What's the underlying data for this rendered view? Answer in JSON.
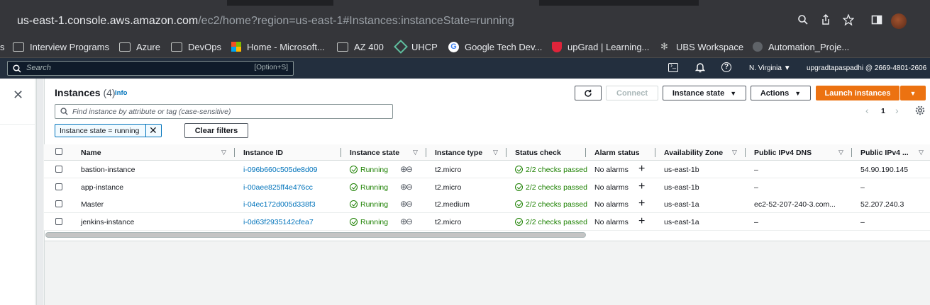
{
  "browser": {
    "url_host": "us-east-1.console.aws.amazon.com",
    "url_path": "/ec2/home?region=us-east-1#Instances:instanceState=running"
  },
  "bookmarks": [
    {
      "label": "Interview Programs",
      "icon": "folder-icon"
    },
    {
      "label": "Azure",
      "icon": "folder-icon"
    },
    {
      "label": "DevOps",
      "icon": "folder-icon"
    },
    {
      "label": "Home - Microsoft...",
      "icon": "microsoft-logo-icon"
    },
    {
      "label": "AZ 400",
      "icon": "folder-icon"
    },
    {
      "label": "UHCP",
      "icon": "uhcp-icon"
    },
    {
      "label": "Google Tech Dev...",
      "icon": "google-icon"
    },
    {
      "label": "upGrad | Learning...",
      "icon": "upgrad-icon"
    },
    {
      "label": "UBS Workspace",
      "icon": "ubs-icon"
    },
    {
      "label": "Automation_Proje...",
      "icon": "github-icon"
    }
  ],
  "aws_nav": {
    "search_placeholder": "Search",
    "search_shortcut": "[Option+S]",
    "region": "N. Virginia",
    "account": "upgradtapaspadhi @ 2669-4801-2606"
  },
  "instances_panel": {
    "title": "Instances",
    "count": "(4)",
    "info_link": "Info",
    "buttons": {
      "connect": "Connect",
      "instance_state": "Instance state",
      "actions": "Actions",
      "launch": "Launch instances"
    },
    "search_placeholder": "Find instance by attribute or tag (case-sensitive)",
    "filter_token": "Instance state = running",
    "clear_filters": "Clear filters",
    "page_number": "1"
  },
  "table": {
    "columns": [
      "Name",
      "Instance ID",
      "Instance state",
      "Instance type",
      "Status check",
      "Alarm status",
      "Availability Zone",
      "Public IPv4 DNS",
      "Public IPv4 ..."
    ],
    "rows": [
      {
        "name": "bastion-instance",
        "id": "i-096b660c505de8d09",
        "state": "Running",
        "type": "t2.micro",
        "status": "2/2 checks passed",
        "alarm": "No alarms",
        "az": "us-east-1b",
        "dns": "–",
        "ip": "54.90.190.145"
      },
      {
        "name": "app-instance",
        "id": "i-00aee825ff4e476cc",
        "state": "Running",
        "type": "t2.micro",
        "status": "2/2 checks passed",
        "alarm": "No alarms",
        "az": "us-east-1b",
        "dns": "–",
        "ip": "–"
      },
      {
        "name": "Master",
        "id": "i-04ec172d005d338f3",
        "state": "Running",
        "type": "t2.medium",
        "status": "2/2 checks passed",
        "alarm": "No alarms",
        "az": "us-east-1a",
        "dns": "ec2-52-207-240-3.com...",
        "ip": "52.207.240.3"
      },
      {
        "name": "jenkins-instance",
        "id": "i-0d63f2935142cfea7",
        "state": "Running",
        "type": "t2.micro",
        "status": "2/2 checks passed",
        "alarm": "No alarms",
        "az": "us-east-1a",
        "dns": "–",
        "ip": "–"
      }
    ]
  },
  "colors": {
    "aws_nav_bg": "#232f3e",
    "primary_orange": "#ec7211",
    "link_blue": "#0073bb",
    "success_green": "#1d8102"
  }
}
